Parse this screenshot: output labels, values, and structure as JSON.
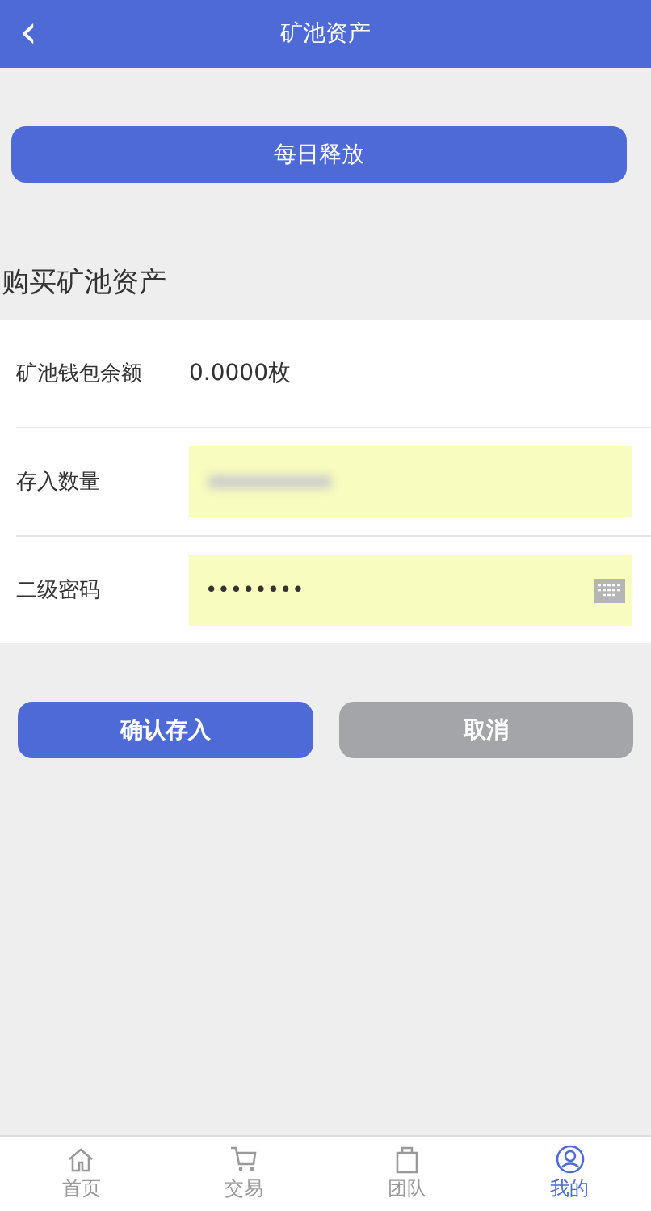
{
  "header": {
    "back_icon": "‹",
    "title": "矿池资产"
  },
  "daily_release_button": "每日释放",
  "section_title": "购买矿池资产",
  "form": [
    {
      "kind": "text",
      "label": "矿池钱包余额",
      "value": "0.0000枚"
    },
    {
      "kind": "blurred",
      "label": "存入数量"
    },
    {
      "kind": "password",
      "label": "二级密码",
      "value": "••••••••"
    }
  ],
  "buttons": [
    {
      "label": "确认存入",
      "kind": "primary"
    },
    {
      "label": "取消",
      "kind": "secondary"
    }
  ],
  "tabbar": [
    {
      "label": "首页",
      "kind": "home",
      "selected": false
    },
    {
      "label": "交易",
      "kind": "cart",
      "selected": false
    },
    {
      "label": "团队",
      "kind": "bag",
      "selected": false
    },
    {
      "label": "我的",
      "kind": "user",
      "selected": true
    }
  ]
}
